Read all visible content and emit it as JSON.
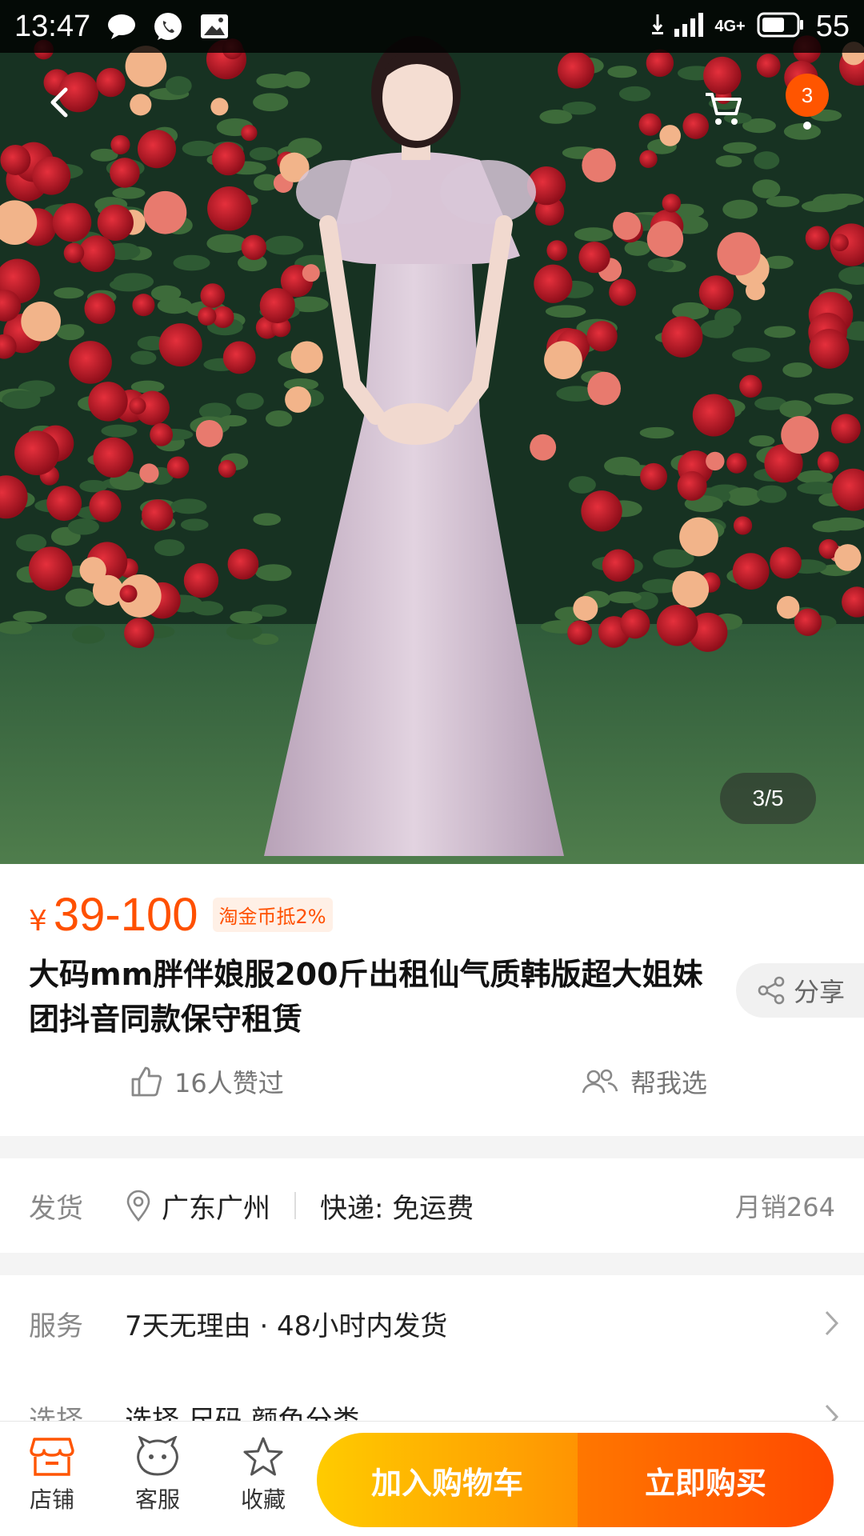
{
  "status_bar": {
    "time": "13:47",
    "network": "4G+",
    "battery": "55",
    "icons": [
      "chat-bubble-icon",
      "whatsapp-icon",
      "gallery-notification-icon",
      "download-icon",
      "signal-icon",
      "battery-icon"
    ]
  },
  "hero": {
    "pager": "3/5",
    "cart_badge": "3",
    "icons": [
      "back-arrow-icon",
      "cart-icon"
    ]
  },
  "product": {
    "currency": "¥",
    "price": "39-100",
    "coin_tag": "淘金币抵2%",
    "title": "大码mm胖伴娘服200斤出租仙气质韩版超大姐妹团抖音同款保守租赁",
    "share_label": "分享",
    "likes_label": "16人赞过",
    "help_choose_label": "帮我选"
  },
  "shipping": {
    "label": "发货",
    "location": "广东广州",
    "express": "快递: 免运费",
    "monthly_sales": "月销264"
  },
  "service": {
    "label": "服务",
    "value": "7天无理由 · 48小时内发货"
  },
  "select": {
    "label": "选择",
    "value": "选择 尺码 颜色分类"
  },
  "bottom_bar": {
    "store": "店铺",
    "customer_service": "客服",
    "favorite": "收藏",
    "add_to_cart": "加入购物车",
    "buy_now": "立即购买"
  },
  "colors": {
    "accent_orange": "#ff5000",
    "cart_gradient_start": "#ffcb00",
    "buy_gradient_end": "#ff4900"
  }
}
